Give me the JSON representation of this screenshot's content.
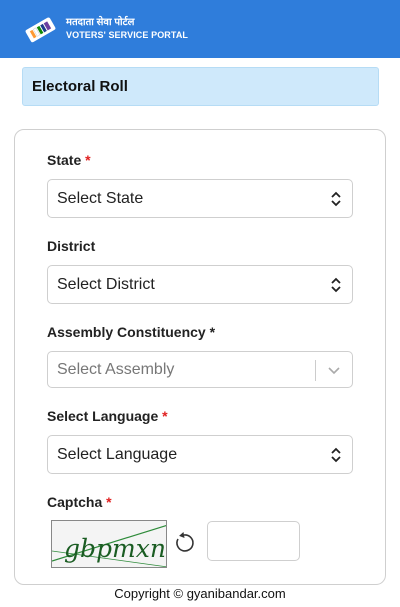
{
  "header": {
    "title_hi": "मतदाता सेवा पोर्टल",
    "title_en": "VOTERS' SERVICE PORTAL",
    "logo_icon": "ballot-box-icon"
  },
  "banner": {
    "title": "Electoral Roll"
  },
  "form": {
    "state": {
      "label": "State",
      "required": "*",
      "value": "Select State"
    },
    "district": {
      "label": "District",
      "value": "Select District"
    },
    "assembly": {
      "label": "Assembly Constituency *",
      "value": "Select Assembly"
    },
    "language": {
      "label": "Select Language",
      "required": "*",
      "value": "Select Language"
    },
    "captcha": {
      "label": "Captcha",
      "required": "*",
      "text": "gbpmxn",
      "input_value": ""
    }
  },
  "footer": {
    "text": "Copyright © gyanibandar.com"
  },
  "colors": {
    "header_bg": "#2f7ddb",
    "banner_bg": "#cfe9fb",
    "required": "#e02020"
  }
}
